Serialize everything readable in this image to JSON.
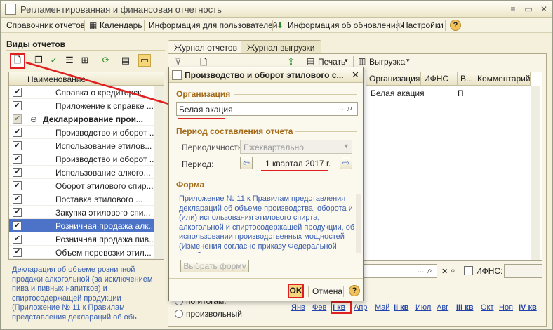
{
  "window": {
    "title": "Регламентированная и финансовая отчетность",
    "menu": [
      "Справочник отчетов",
      "Календарь",
      "Информация для пользователей",
      "Информация об обновлениях",
      "Настройки"
    ]
  },
  "left": {
    "section_title": "Виды отчетов",
    "column_header": "Наименование",
    "rows": [
      {
        "label": "Справка о кредиторск"
      },
      {
        "label": "Приложение к справке ..."
      },
      {
        "label": "Декларирование прои..."
      },
      {
        "label": "Производство и оборот ..."
      },
      {
        "label": "Использование этилов..."
      },
      {
        "label": "Производство и оборот ..."
      },
      {
        "label": "Использование алкого..."
      },
      {
        "label": "Оборот этилового спир..."
      },
      {
        "label": "Поставка этилового ..."
      },
      {
        "label": "Закупка этилового спи..."
      },
      {
        "label": "Розничная продажа алк..."
      },
      {
        "label": "Розничная продажа пив..."
      },
      {
        "label": "Объем перевозки этил..."
      }
    ],
    "description": "Декларация об объеме розничной продажи алкогольной (за исключением пива и пивных напитков) и спиртосодержащей продукции (Приложение № 11 к Правилам представления деклараций об обь"
  },
  "tabs": [
    "Журнал отчетов",
    "Журнал выгрузки"
  ],
  "toolbar": {
    "print_label": "Печать",
    "export_label": "Выгрузка"
  },
  "grid": {
    "headers": [
      "Организация",
      "ИФНС",
      "В...",
      "Комментарий"
    ],
    "row": {
      "org": "Белая акация",
      "ifns": "П"
    }
  },
  "bottom": {
    "ifns_label": "ИФНС:",
    "radio_period_label": "по итогам:",
    "radio_custom_label": "произвольный",
    "months": [
      "Янв",
      "Фев",
      "I кв",
      "Апр",
      "Май",
      "II кв",
      "Июл",
      "Авг",
      "III кв",
      "Окт",
      "Ноя",
      "IV кв"
    ]
  },
  "dialog": {
    "title": "Производство и оборот этилового с...",
    "org_group": "Организация",
    "org_value": "Белая акация",
    "period_group": "Период составления отчета",
    "periodicity_label": "Периодичность:",
    "periodicity_value": "Ежеквартально",
    "period_label": "Период:",
    "period_value": "1 квартал 2017 г.",
    "form_group": "Форма",
    "form_text": "Приложение № 11 к Правилам представления деклараций об объеме производства, оборота и (или) использования этилового спирта, алкогольной и спиртосодержащей продукции, об использовании производственных мощностей (Изменения согласно приказу Федеральной службы по регулированию",
    "choose_form": "Выбрать форму",
    "ok": "OK",
    "cancel": "Отмена",
    "help": "?"
  },
  "colors": {
    "accent_red": "#e02020",
    "selection": "#4c73c8",
    "group_title": "#a36a18",
    "link": "#2244aa"
  }
}
